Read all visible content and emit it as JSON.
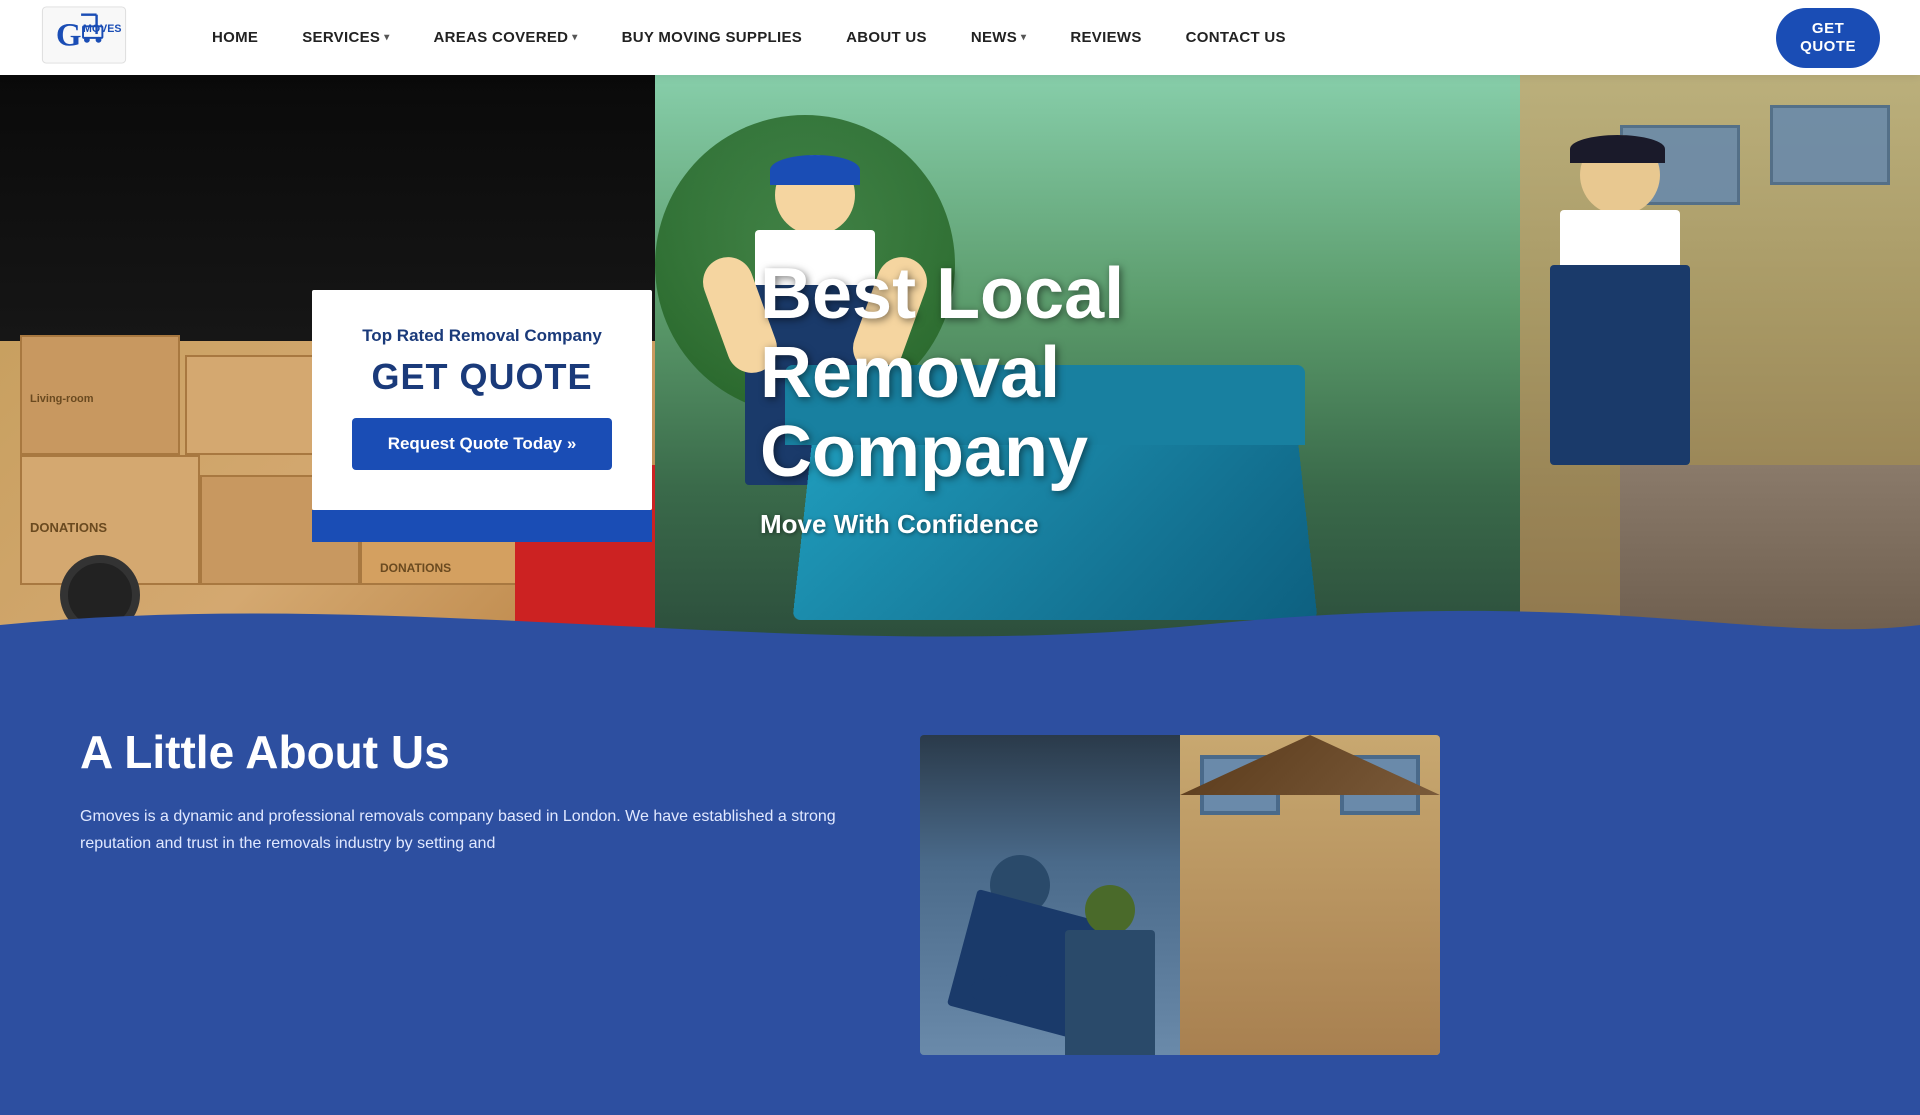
{
  "navbar": {
    "logo_alt": "GMoves Logo",
    "links": [
      {
        "label": "HOME",
        "has_dropdown": false
      },
      {
        "label": "SERVICES",
        "has_dropdown": true
      },
      {
        "label": "AREAS COVERED",
        "has_dropdown": true
      },
      {
        "label": "BUY MOVING SUPPLIES",
        "has_dropdown": false
      },
      {
        "label": "ABOUT US",
        "has_dropdown": false
      },
      {
        "label": "NEWS",
        "has_dropdown": true
      },
      {
        "label": "REVIEWS",
        "has_dropdown": false
      },
      {
        "label": "CONTACT US",
        "has_dropdown": false
      }
    ],
    "cta_line1": "GET",
    "cta_line2": "QUOTE",
    "cta_label": "GET\nQUOTE"
  },
  "hero": {
    "card": {
      "subtitle": "Top Rated Removal Company",
      "title": "GET QUOTE",
      "button_label": "Request Quote Today »"
    },
    "headline_main": "Best Local\nRemoval\nCompany",
    "headline_sub": "Move With Confidence"
  },
  "about": {
    "heading": "A Little About Us",
    "paragraph": "Gmoves is a dynamic and professional removals company based in London. We have established a strong reputation and trust in the removals industry by setting and"
  },
  "colors": {
    "primary_blue": "#1a4db5",
    "dark_blue": "#2d4fa0",
    "text_dark": "#222222",
    "white": "#ffffff"
  }
}
